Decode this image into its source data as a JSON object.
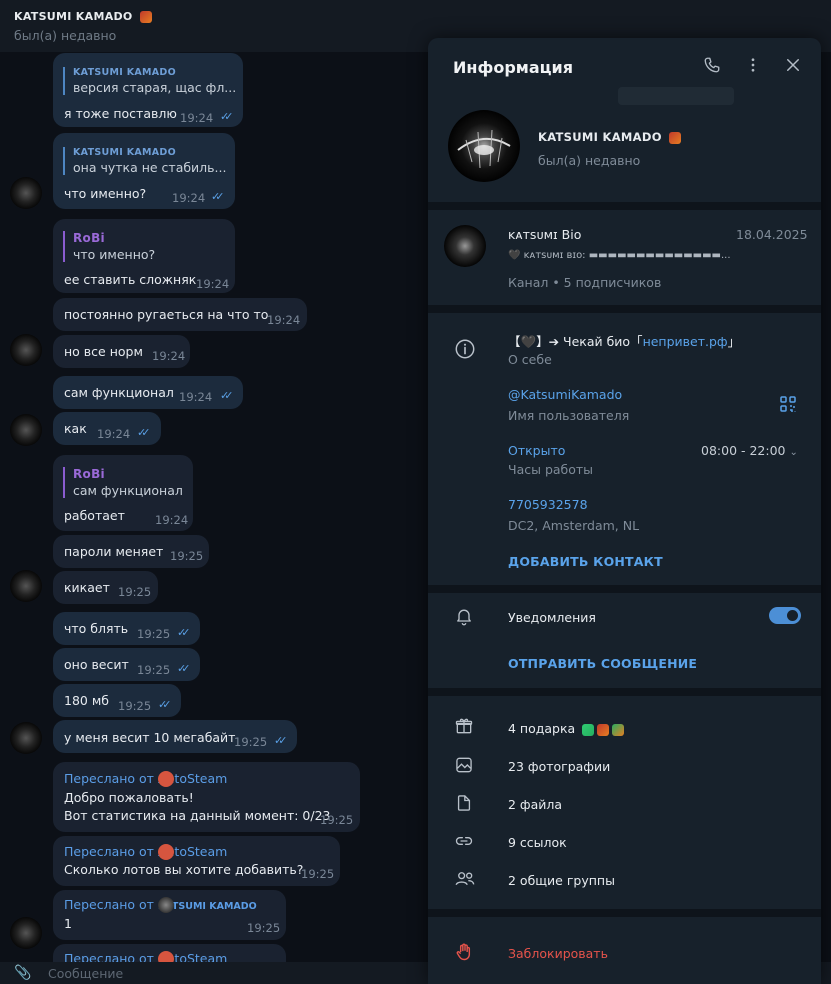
{
  "chat": {
    "header": {
      "name": "KATSUMI KAMADO",
      "status": "был(а) недавно"
    },
    "messages": [
      {
        "reply_name": "KATSUMI KAMADO",
        "reply_text": "версия старая, щас фл...",
        "text": "я тоже поставлю",
        "time": "19:24",
        "ticks": "✓✓"
      },
      {
        "reply_name": "KATSUMI KAMADO",
        "reply_text": "она чутка не стабиль...",
        "text": "что именно?",
        "time": "19:24",
        "ticks": "✓✓"
      },
      {
        "reply_name": "RoBi",
        "reply_text": "что именно?",
        "text": "ее ставить сложняк",
        "time": "19:24"
      },
      {
        "text": "постоянно ругаеться на что то",
        "time": "19:24"
      },
      {
        "text": "но все норм",
        "time": "19:24"
      },
      {
        "text": "сам функционал",
        "time": "19:24",
        "ticks": "✓✓"
      },
      {
        "text": "как",
        "time": "19:24",
        "ticks": "✓✓"
      },
      {
        "reply_name": "RoBi",
        "reply_text": "сам функционал",
        "text": "работает",
        "time": "19:24"
      },
      {
        "text": "пароли меняет",
        "time": "19:25"
      },
      {
        "text": "кикает",
        "time": "19:25"
      },
      {
        "text": "что блять",
        "time": "19:25",
        "ticks": "✓✓"
      },
      {
        "text": "оно весит",
        "time": "19:25",
        "ticks": "✓✓"
      },
      {
        "text": "180 мб",
        "time": "19:25",
        "ticks": "✓✓"
      },
      {
        "text": "у меня весит 10 мегабайт",
        "time": "19:25",
        "ticks": "✓✓"
      },
      {
        "fwd_label": "Переслано от",
        "fwd_from": "AutoSteam",
        "line1": "Добро пожаловать!",
        "line2": "Вот статистика на данный момент: 0/23",
        "time": "19:25"
      },
      {
        "fwd_label": "Переслано от",
        "fwd_from": "AutoSteam",
        "line1": "Сколько лотов вы хотите добавить?",
        "time": "19:25"
      },
      {
        "fwd_label": "Переслано от",
        "fwd_from": "KATSUMI KAMADO",
        "line1": "1",
        "time": "19:25"
      },
      {
        "fwd_label": "Переслано от",
        "fwd_from": "AutoSteam"
      }
    ],
    "composer_placeholder": "Сообщение"
  },
  "panel": {
    "title": "Информация",
    "profile": {
      "name": "KATSUMI KAMADO",
      "status": "был(а) недавно"
    },
    "channel": {
      "name": "ᴋᴀᴛsᴜᴍɪ Bio",
      "date": "18.04.2025",
      "preview": "🖤 ᴋᴀᴛsᴜᴍɪ ʙɪᴏ: ▬▬▬▬▬▬▬▬▬▬▬▬▬▬...",
      "meta": "Канал • 5 подписчиков"
    },
    "bio": {
      "prefix": "【🖤】➔ Чекай био「",
      "link": "непривет.рф",
      "suffix": "」",
      "label": "О себе"
    },
    "username": {
      "value": "@KatsumiKamado",
      "label": "Имя пользователя"
    },
    "hours": {
      "status": "Открыто",
      "label": "Часы работы",
      "range": "08:00 - 22:00"
    },
    "phone": {
      "value": "7705932578",
      "label": "DC2, Amsterdam, NL"
    },
    "add_contact": "ДОБАВИТЬ КОНТАКТ",
    "notifications": {
      "label": "Уведомления",
      "enabled": true
    },
    "send_message": "ОТПРАВИТЬ СООБЩЕНИЕ",
    "media": {
      "gifts": "4 подарка",
      "photos": "23 фотографии",
      "files": "2 файла",
      "links": "9 ссылок",
      "groups": "2 общие группы"
    },
    "block": "Заблокировать"
  },
  "colors": {
    "accent": "#5aa3ea",
    "danger": "#e5534b",
    "panel_bg": "#17212b",
    "bubble_out": "#1c2b3d"
  }
}
